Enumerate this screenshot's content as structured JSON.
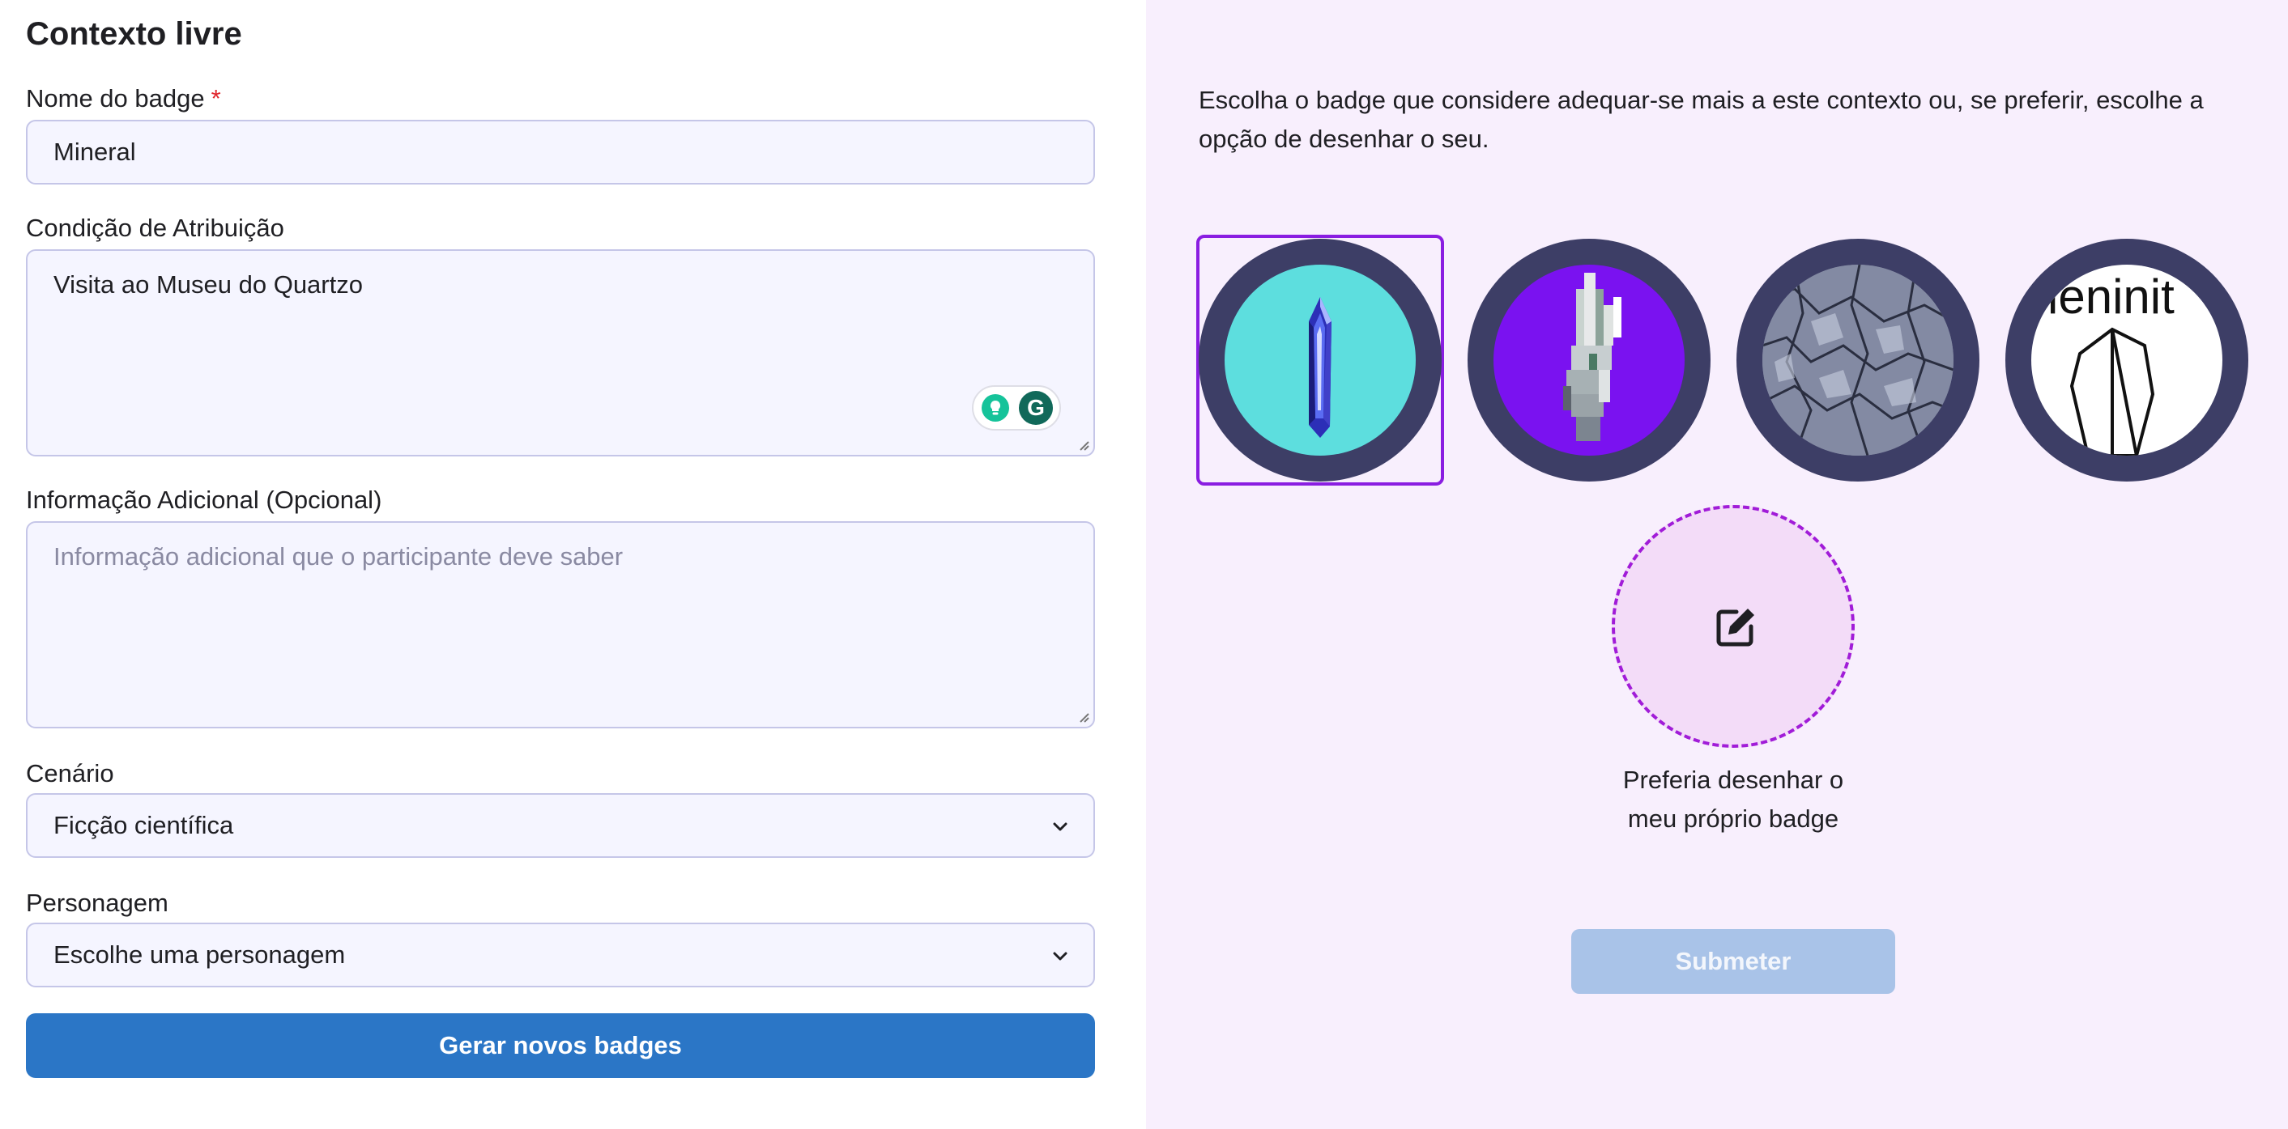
{
  "form": {
    "title": "Contexto livre",
    "badge_name": {
      "label": "Nome do badge",
      "required_mark": "*",
      "value": "Mineral"
    },
    "condition": {
      "label": "Condição de Atribuição",
      "value": "Visita ao Museu do Quartzo"
    },
    "extra_info": {
      "label": "Informação Adicional (Opcional)",
      "placeholder": "Informação adicional que o participante deve saber"
    },
    "scenario": {
      "label": "Cenário",
      "selected": "Ficção científica"
    },
    "character": {
      "label": "Personagem",
      "selected": "Escolhe uma personagem"
    },
    "generate_button": "Gerar novos badges"
  },
  "chooser": {
    "instructions": "Escolha o badge que considere adequar-se mais a este contexto ou, se preferir, escolhe a opção de desenhar o seu.",
    "badges": [
      {
        "name": "blue crystal badge",
        "selected": true
      },
      {
        "name": "pixel crystal badge",
        "selected": false
      },
      {
        "name": "quartz texture badge",
        "selected": false
      },
      {
        "name": "crystal sketch badge",
        "selected": false,
        "overlay_text": "ieninit"
      }
    ],
    "draw_option_label": "Preferia desenhar o meu próprio badge",
    "submit_button": "Submeter"
  },
  "colors": {
    "primary": "#2b76c6",
    "selected_border": "#8a1de1",
    "badge_ring": "#3d3e66",
    "panel_bg": "#f8effd",
    "submit_disabled": "#a9c3e8"
  }
}
